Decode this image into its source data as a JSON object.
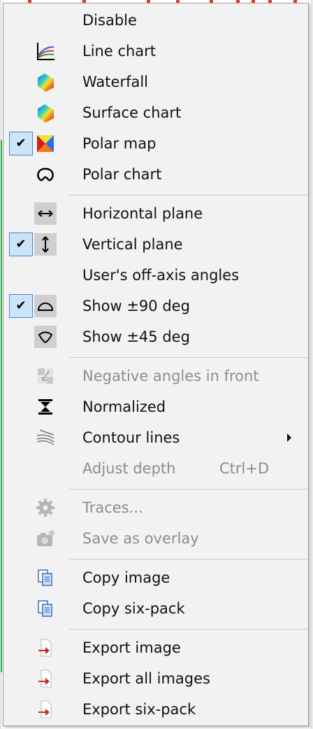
{
  "menu": {
    "items": [
      {
        "label": "Disable"
      },
      {
        "label": "Line chart",
        "icon": "line-chart-icon"
      },
      {
        "label": "Waterfall",
        "icon": "waterfall-icon"
      },
      {
        "label": "Surface chart",
        "icon": "surface-chart-icon"
      },
      {
        "label": "Polar map",
        "icon": "polar-map-icon",
        "checked": true
      },
      {
        "label": "Polar chart",
        "icon": "polar-chart-icon"
      },
      {
        "label": "Horizontal plane",
        "icon": "horizontal-arrows-icon"
      },
      {
        "label": "Vertical plane",
        "icon": "vertical-arrows-icon",
        "checked": true
      },
      {
        "label": "User's off-axis angles"
      },
      {
        "label": "Show ±90 deg",
        "icon": "half-circle-icon",
        "checked": true
      },
      {
        "label": "Show ±45 deg",
        "icon": "lens-icon"
      },
      {
        "label": "Negative angles in front",
        "icon": "swap-quadrants-icon",
        "disabled": true
      },
      {
        "label": "Normalized",
        "icon": "normalize-icon"
      },
      {
        "label": "Contour lines",
        "icon": "contour-lines-icon",
        "submenu": true
      },
      {
        "label": "Adjust depth",
        "shortcut": "Ctrl+D",
        "disabled": true
      },
      {
        "label": "Traces...",
        "icon": "gear-icon",
        "disabled": true
      },
      {
        "label": "Save as overlay",
        "icon": "camera-icon",
        "disabled": true
      },
      {
        "label": "Copy image",
        "icon": "copy-icon"
      },
      {
        "label": "Copy six-pack",
        "icon": "copy-icon"
      },
      {
        "label": "Export image",
        "icon": "export-icon"
      },
      {
        "label": "Export all images",
        "icon": "export-icon"
      },
      {
        "label": "Export six-pack",
        "icon": "export-icon"
      }
    ]
  },
  "colors": {
    "menu_bg": "#f2f2f2",
    "check_bg": "#cde3f7",
    "check_border": "#3d86d6",
    "disabled_text": "#8d8d8d",
    "export_arrow": "#c0282d",
    "copy_blue": "#3a6fc4"
  }
}
